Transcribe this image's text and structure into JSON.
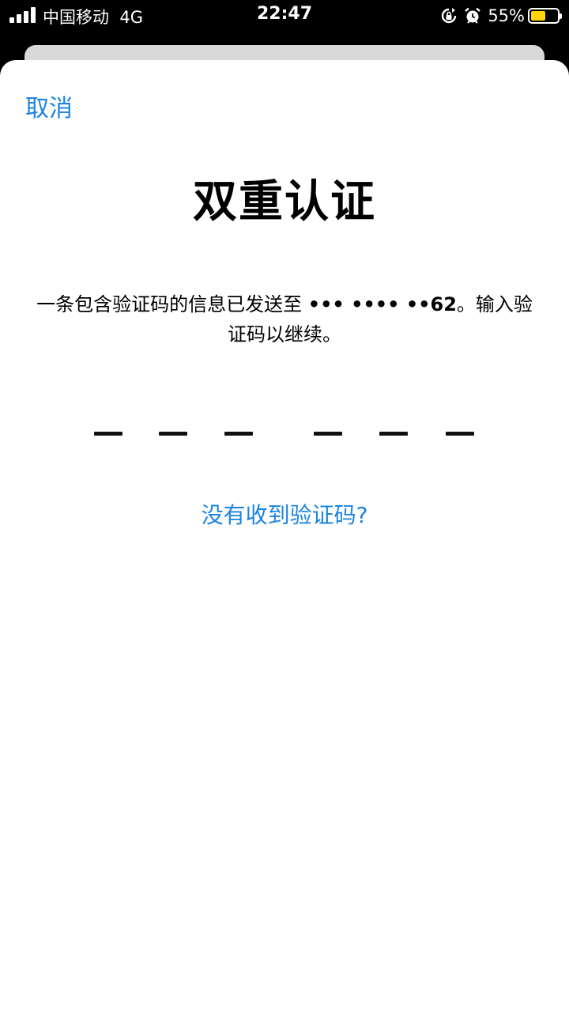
{
  "status_bar": {
    "carrier": "中国移动",
    "network": "4G",
    "time": "22:47",
    "battery_percent": "55%",
    "battery_level": 0.55,
    "battery_color": "#ffd60a",
    "icons": [
      "signal-icon",
      "orientation-lock-icon",
      "alarm-icon",
      "battery-icon"
    ]
  },
  "sheet": {
    "cancel_label": "取消",
    "title": "双重认证",
    "message_prefix": "一条包含验证码的信息已发送至 ",
    "masked_number": "••• •••• ••62",
    "message_suffix": "。输入验证码以继续。",
    "code_slots": 6,
    "no_code_label": "没有收到验证码?"
  },
  "colors": {
    "accent": "#1a84e0",
    "background": "#ffffff"
  }
}
